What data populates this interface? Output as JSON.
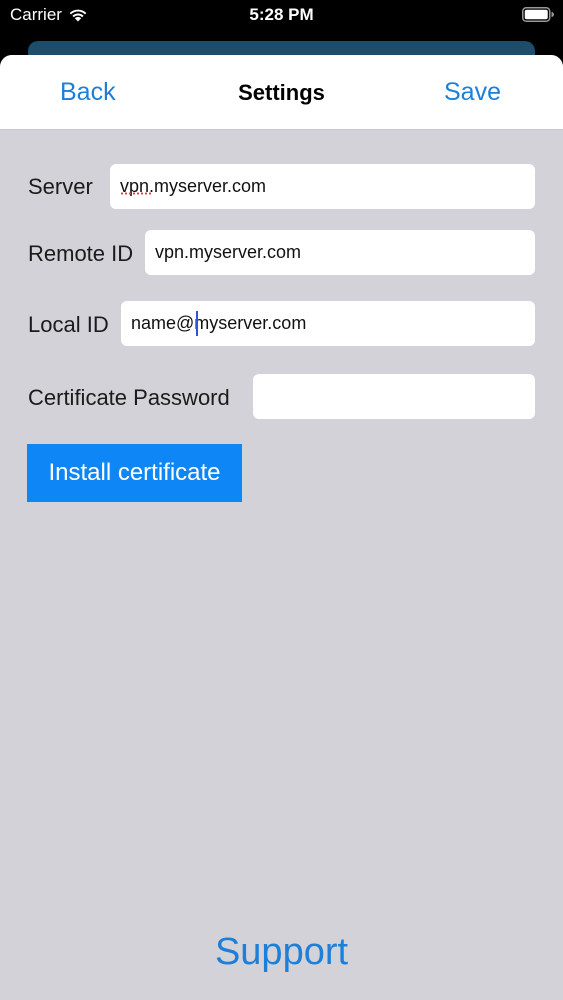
{
  "status_bar": {
    "carrier": "Carrier",
    "time": "5:28 PM",
    "wifi_icon": "wifi-icon",
    "battery_icon": "battery-icon"
  },
  "nav": {
    "back_label": "Back",
    "title": "Settings",
    "save_label": "Save"
  },
  "form": {
    "server": {
      "label": "Server",
      "value": "vpn.myserver.com"
    },
    "remote_id": {
      "label": "Remote ID",
      "value": "vpn.myserver.com"
    },
    "local_id": {
      "label": "Local ID",
      "value": "name@myserver.com"
    },
    "certificate_password": {
      "label": "Certificate Password",
      "value": ""
    }
  },
  "install_button_label": "Install certificate",
  "support_label": "Support",
  "colors": {
    "accent": "#1c7fd9",
    "button": "#0f86f5",
    "background": "#d3d2d8",
    "back_sheet": "#1d4d6b"
  }
}
